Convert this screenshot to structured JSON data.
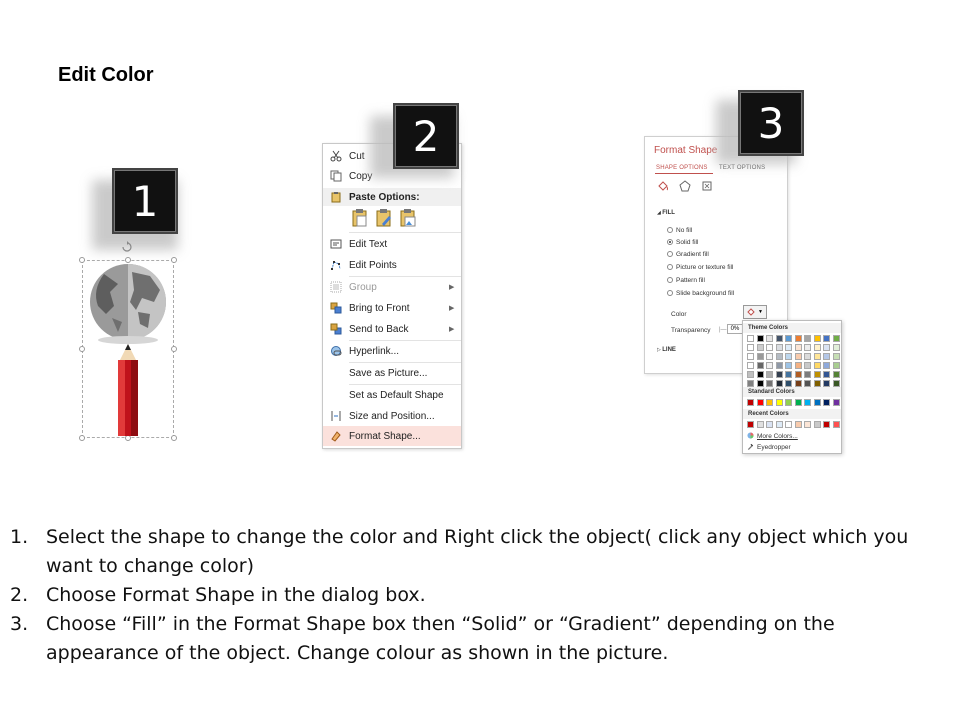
{
  "title": "Edit Color",
  "steps": {
    "one": "1",
    "two": "2",
    "three": "3"
  },
  "context_menu": {
    "cut": "Cut",
    "copy": "Copy",
    "paste_options": "Paste Options:",
    "edit_text": "Edit Text",
    "edit_points": "Edit Points",
    "group": "Group",
    "bring_to_front": "Bring to Front",
    "send_to_back": "Send to Back",
    "hyperlink": "Hyperlink...",
    "save_as_picture": "Save as Picture...",
    "set_default_shape": "Set as Default Shape",
    "size_position": "Size and Position...",
    "format_shape": "Format Shape..."
  },
  "format_pane": {
    "title": "Format Shape",
    "tab_shape": "SHAPE OPTIONS",
    "tab_text": "TEXT OPTIONS",
    "fill_section": "FILL",
    "options": [
      "No fill",
      "Solid fill",
      "Gradient fill",
      "Picture or texture fill",
      "Pattern fill",
      "Slide background fill"
    ],
    "selected_option": "Solid fill",
    "color_label": "Color",
    "transparency_label": "Transparency",
    "transparency_value": "0%",
    "line_section": "LINE"
  },
  "palette": {
    "theme_colors": "Theme Colors",
    "standard_colors": "Standard Colors",
    "recent_colors": "Recent Colors",
    "more_colors": "More Colors...",
    "eyedropper": "Eyedropper",
    "theme_top": [
      "#ffffff",
      "#000000",
      "#e7e6e6",
      "#44546a",
      "#5b9bd5",
      "#ed7d31",
      "#a5a5a5",
      "#ffc000",
      "#4472c4",
      "#70ad47"
    ],
    "standard": [
      "#c00000",
      "#ff0000",
      "#ffc000",
      "#ffff00",
      "#92d050",
      "#00b050",
      "#00b0f0",
      "#0070c0",
      "#002060",
      "#7030a0"
    ],
    "recent": [
      "#c00000",
      "#e0e0e0",
      "#dae3f3",
      "#deebf7",
      "#ffffff",
      "#f8cbad",
      "#fbe5d6",
      "#c9c9c9",
      "#c00000",
      "#ff5050"
    ]
  },
  "instructions": [
    {
      "num": "1.",
      "text": "Select the shape to change the color and Right click the object( click any object which you want to change color)"
    },
    {
      "num": "2.",
      "text": "Choose Format Shape in the dialog box."
    },
    {
      "num": "3.",
      "text": "Choose “Fill” in the Format Shape box then “Solid” or “Gradient” depending on the appearance of the object. Change colour as shown in the picture."
    }
  ]
}
